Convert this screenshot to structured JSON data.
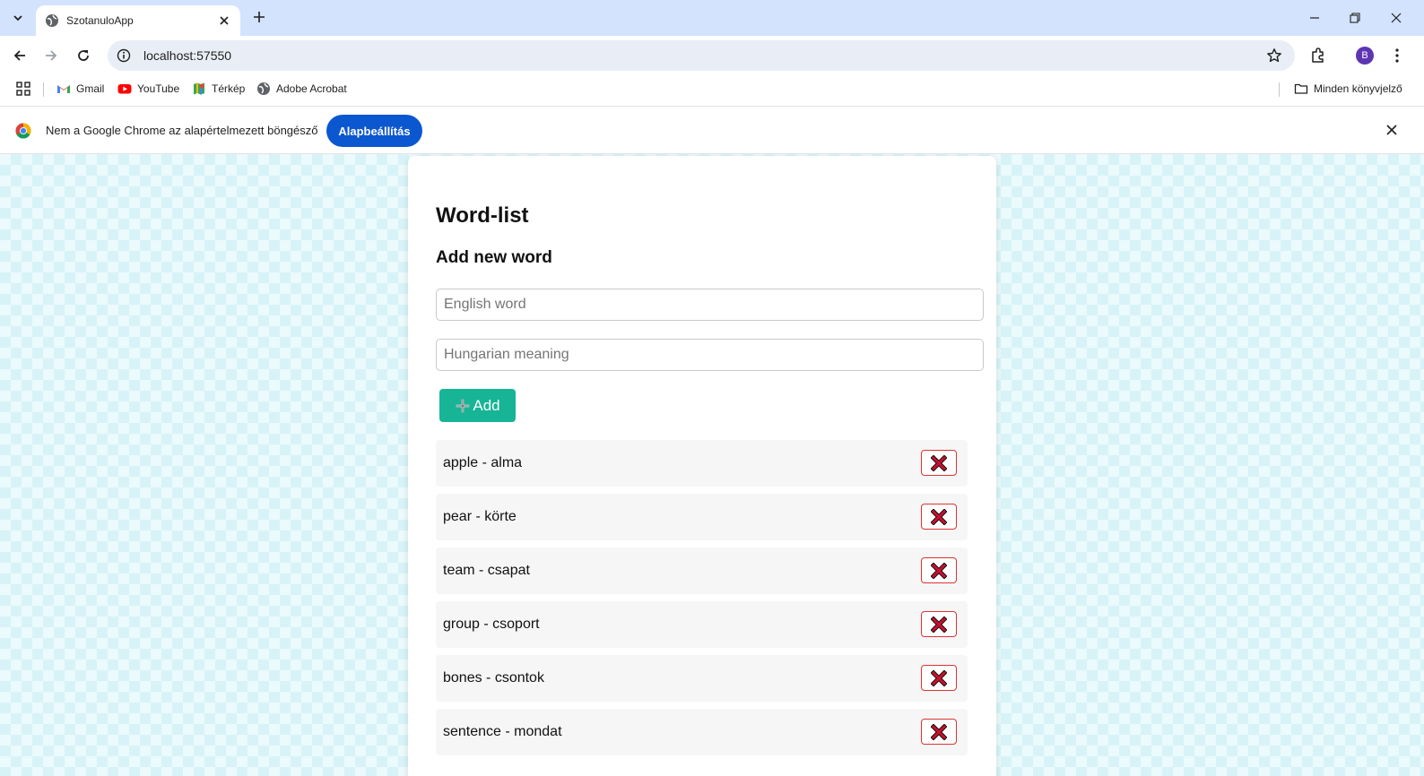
{
  "browser": {
    "tab_title": "SzotanuloApp",
    "url": "localhost:57550",
    "avatar_letter": "B",
    "bookmarks": [
      {
        "label": "Gmail",
        "icon": "gmail-icon"
      },
      {
        "label": "YouTube",
        "icon": "youtube-icon"
      },
      {
        "label": "Térkép",
        "icon": "maps-icon"
      },
      {
        "label": "Adobe Acrobat",
        "icon": "globe-icon"
      }
    ],
    "all_bookmarks_label": "Minden könyvjelző",
    "infobar": {
      "message": "Nem a Google Chrome az alapértelmezett böngésző",
      "button_label": "Alapbeállítás"
    }
  },
  "app": {
    "title": "Word-list",
    "subtitle": "Add new word",
    "english_placeholder": "English word",
    "hungarian_placeholder": "Hungarian meaning",
    "add_label": "Add",
    "words": [
      {
        "text": "apple - alma"
      },
      {
        "text": "pear - körte"
      },
      {
        "text": "team - csapat"
      },
      {
        "text": "group - csoport"
      },
      {
        "text": "bones - csontok"
      },
      {
        "text": "sentence - mondat"
      }
    ]
  },
  "colors": {
    "accent_add": "#17b495",
    "delete_border": "#dd3333",
    "chrome_primary": "#0b57d0"
  }
}
